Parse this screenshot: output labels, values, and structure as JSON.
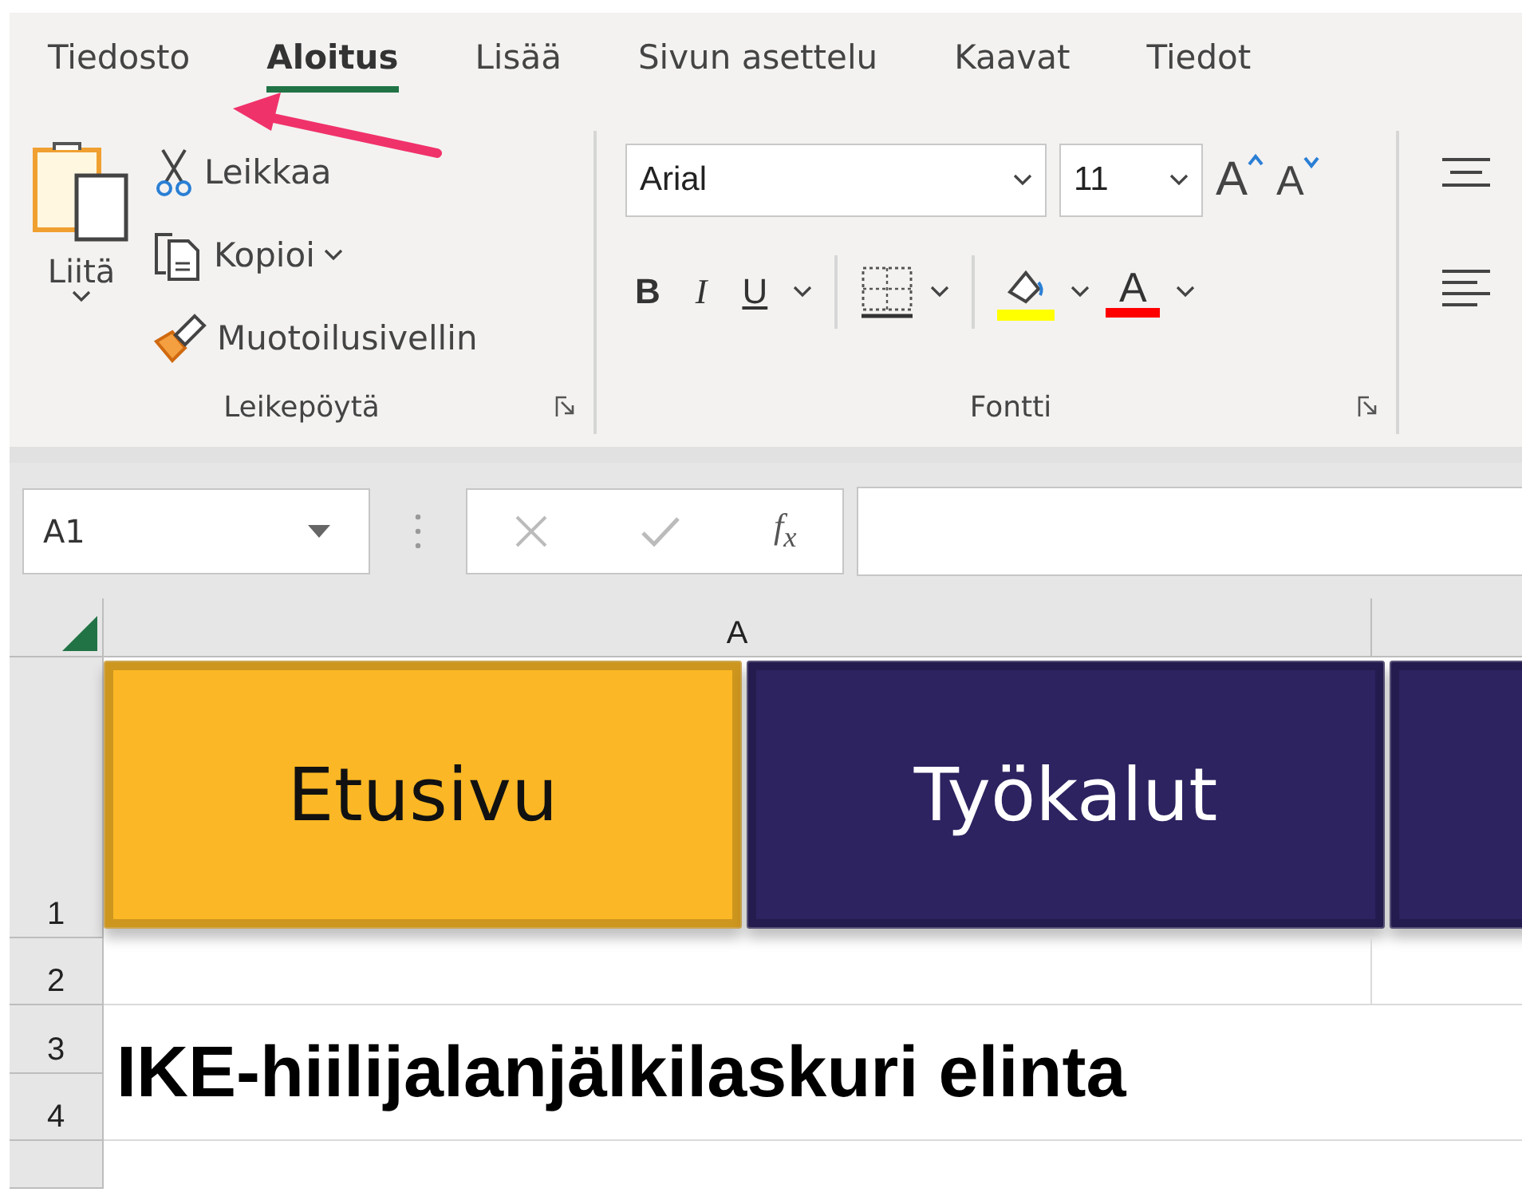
{
  "tabs": [
    {
      "label": "Tiedosto",
      "selected": false
    },
    {
      "label": "Aloitus",
      "selected": true
    },
    {
      "label": "Lisää",
      "selected": false
    },
    {
      "label": "Sivun asettelu",
      "selected": false
    },
    {
      "label": "Kaavat",
      "selected": false
    },
    {
      "label": "Tiedot",
      "selected": false
    }
  ],
  "clipboard": {
    "paste": "Liitä",
    "cut": "Leikkaa",
    "copy": "Kopioi",
    "format_painter": "Muotoilusivellin",
    "group_label": "Leikepöytä"
  },
  "font": {
    "font_name": "Arial",
    "font_size": "11",
    "grow": "A",
    "shrink": "A",
    "bold": "B",
    "italic": "I",
    "underline": "U",
    "font_color": "A",
    "group_label": "Fontti"
  },
  "formula_bar": {
    "name_box": "A1",
    "function_label": "f$_{x}$"
  },
  "sheet": {
    "columns": [
      "A"
    ],
    "row_headers": [
      "1",
      "2",
      "3",
      "4"
    ],
    "nav_buttons": [
      {
        "label": "Etusivu",
        "selected": true
      },
      {
        "label": "Työkalut",
        "selected": false
      },
      {
        "selected": false
      }
    ],
    "title": "IKE-hiilijalanjälkilaskuri elinta"
  }
}
